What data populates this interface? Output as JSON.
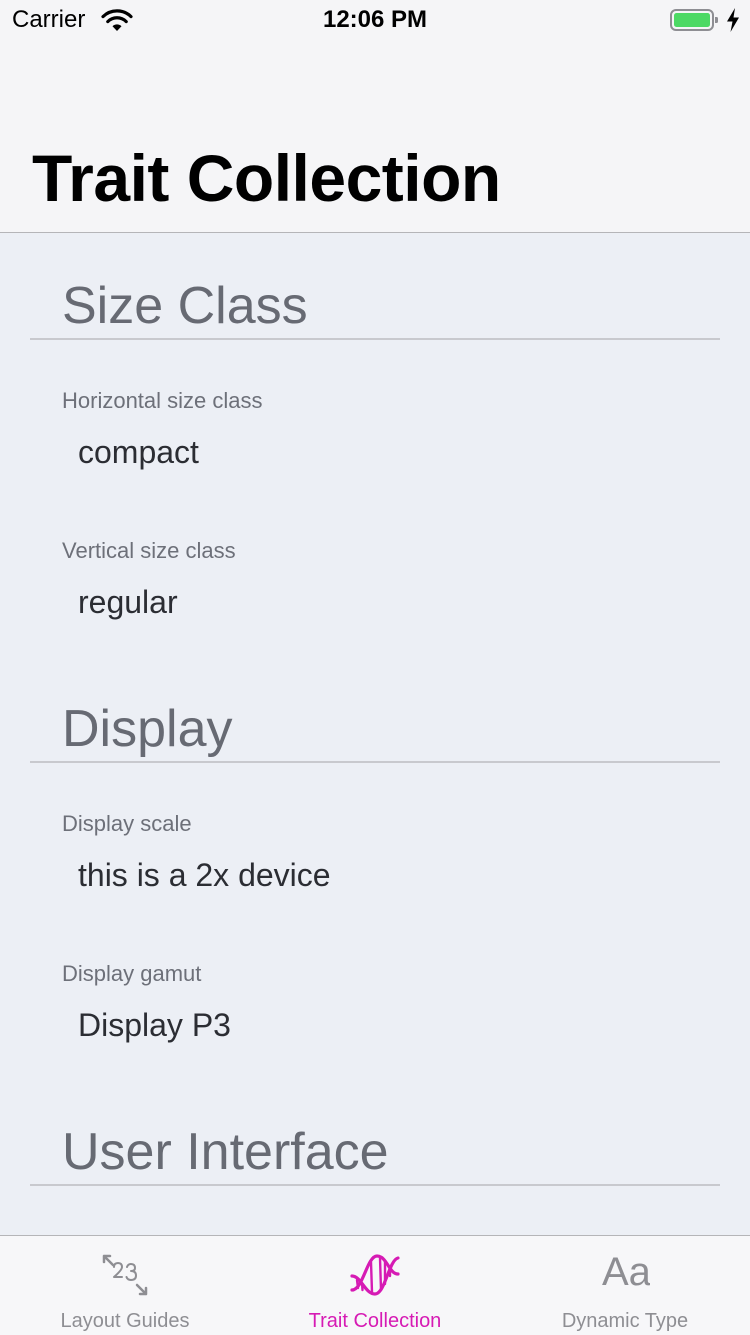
{
  "status_bar": {
    "carrier": "Carrier",
    "time": "12:06 PM",
    "battery_color": "#4cd964"
  },
  "nav": {
    "title": "Trait Collection"
  },
  "sections": [
    {
      "title": "Size Class",
      "fields": [
        {
          "label": "Horizontal size class",
          "value": "compact"
        },
        {
          "label": "Vertical size class",
          "value": "regular"
        }
      ]
    },
    {
      "title": "Display",
      "fields": [
        {
          "label": "Display scale",
          "value": "this is a 2x device"
        },
        {
          "label": "Display gamut",
          "value": "Display P3"
        }
      ]
    },
    {
      "title": "User Interface",
      "fields": []
    }
  ],
  "tab_bar": {
    "accent_color": "#d61bb4",
    "inactive_color": "#8e8e93",
    "selected_index": 1,
    "tabs": [
      {
        "label": "Layout Guides",
        "icon": "layout-guides-icon"
      },
      {
        "label": "Trait Collection",
        "icon": "dna-icon"
      },
      {
        "label": "Dynamic Type",
        "icon": "text-size-icon",
        "icon_text": "Aa"
      }
    ]
  }
}
